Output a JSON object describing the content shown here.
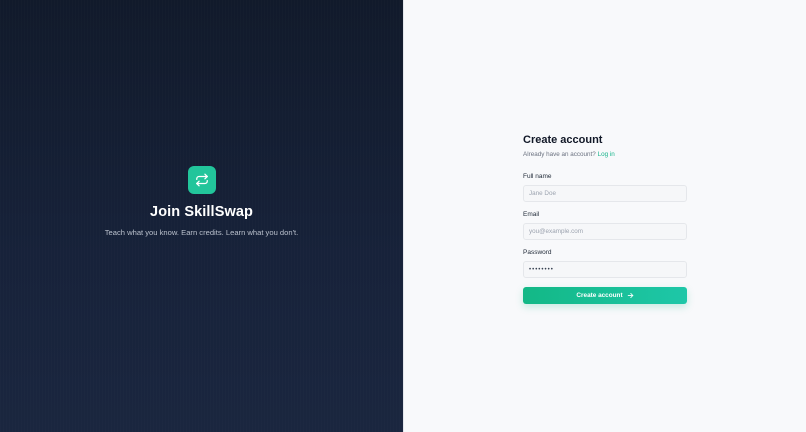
{
  "brand": {
    "logo_icon": "swap-arrows-icon",
    "title": "Join SkillSwap",
    "tagline": "Teach what you know. Earn credits. Learn what you don't."
  },
  "form": {
    "title": "Create account",
    "subtitle_prefix": "Already have an account?",
    "login_link": "Log in",
    "fields": {
      "name": {
        "label": "Full name",
        "placeholder": "Jane Doe",
        "value": ""
      },
      "email": {
        "label": "Email",
        "placeholder": "you@example.com",
        "value": ""
      },
      "password": {
        "label": "Password",
        "placeholder": "",
        "value": "password"
      }
    },
    "submit_label": "Create account",
    "submit_icon": "arrow-right-icon"
  },
  "colors": {
    "accent": "#22c59b",
    "left_bg": "#111a2b",
    "right_bg": "#f8f9fb",
    "link": "#16b38a"
  }
}
